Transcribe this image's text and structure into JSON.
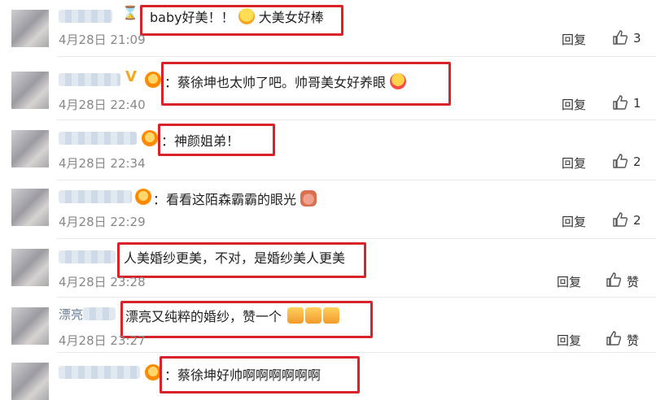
{
  "comments": [
    {
      "text": "baby好美！！",
      "text2": "大美女好棒",
      "date": "4月28日 21:09",
      "reply": "回复",
      "likes": "3"
    },
    {
      "text": "：蔡徐坤也太帅了吧。帅哥美女好养眼",
      "date": "4月28日 22:40",
      "reply": "回复",
      "likes": "1"
    },
    {
      "text": "：神颜姐弟！",
      "date": "4月28日 22:34",
      "reply": "回复",
      "likes": "2"
    },
    {
      "text": "：看看这陌森霸霸的眼光",
      "date": "4月28日 22:29",
      "reply": "回复",
      "likes": "2"
    },
    {
      "text": "人美婚纱更美，不对，是婚纱美人更美",
      "date": "4月28日 23:28",
      "reply": "回复",
      "likes": "赞"
    },
    {
      "text": "漂亮又纯粹的婚纱，赞一个",
      "date": "4月28日 23:27",
      "reply": "回复",
      "likes": "赞"
    },
    {
      "text": "：蔡徐坤好帅啊啊啊啊啊啊"
    }
  ],
  "partial_name": "漂亮"
}
